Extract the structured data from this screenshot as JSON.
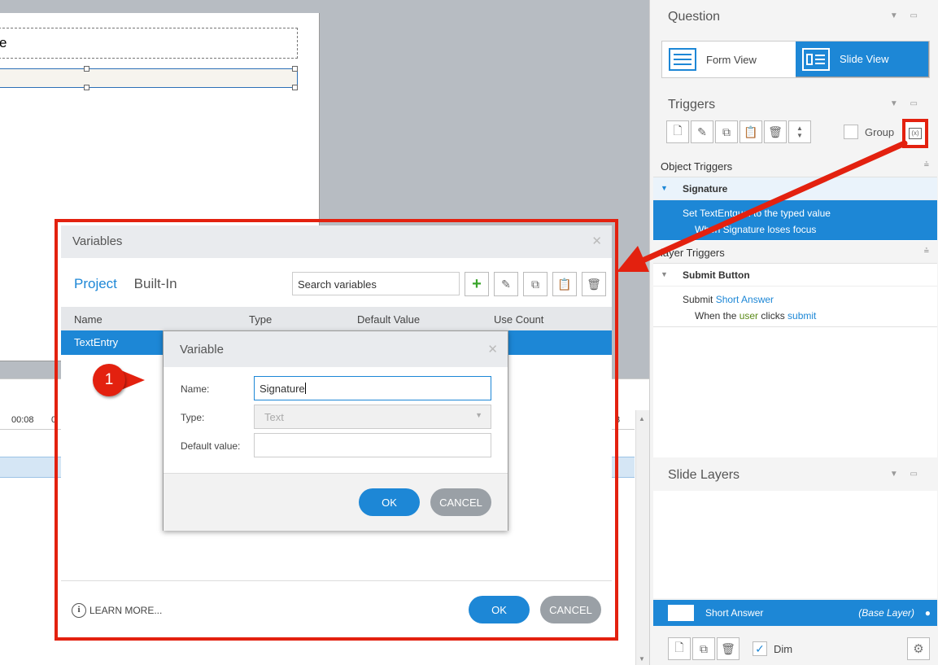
{
  "slide": {
    "title_fragment": "e"
  },
  "timeline": {
    "ticks": [
      "00:08",
      "0",
      "3"
    ]
  },
  "right_panel": {
    "question": {
      "title": "Question",
      "form_view": "Form View",
      "slide_view": "Slide View"
    },
    "triggers": {
      "title": "Triggers",
      "group_label": "Group",
      "object_triggers_label": "Object Triggers",
      "signature_group": "Signature",
      "trigger1_line1_pre": "Set TextEnt",
      "trigger1_line1_post": "qual to the typed value",
      "trigger1_line2": "When Signature loses focus",
      "player_triggers_label": "layer Triggers",
      "submit_group": "Submit Button",
      "trigger2_pre": "Submit ",
      "trigger2_link": "Short Answer",
      "trigger2_l2_pre": "When the ",
      "trigger2_l2_user": "user",
      "trigger2_l2_mid": " clicks ",
      "trigger2_l2_link": "submit"
    },
    "slide_layers": {
      "title": "Slide Layers",
      "layer_name": "Short Answer",
      "layer_tag": "(Base Layer)",
      "dim_label": "Dim"
    }
  },
  "variables_dialog": {
    "title": "Variables",
    "tab_project": "Project",
    "tab_builtin": "Built-In",
    "search_placeholder": "Search variables",
    "columns": [
      "Name",
      "Type",
      "Default Value",
      "Use Count"
    ],
    "selected_row": "TextEntry",
    "learn_more": "LEARN MORE...",
    "ok": "OK",
    "cancel": "CANCEL"
  },
  "variable_dialog": {
    "title": "Variable",
    "name_label": "Name:",
    "name_value": "Signature",
    "type_label": "Type:",
    "type_value": "Text",
    "default_label": "Default value:",
    "default_value": "",
    "ok": "OK",
    "cancel": "CANCEL"
  },
  "callout": {
    "number": "1"
  },
  "colors": {
    "accent": "#1d87d6",
    "highlight": "#e3210f"
  }
}
